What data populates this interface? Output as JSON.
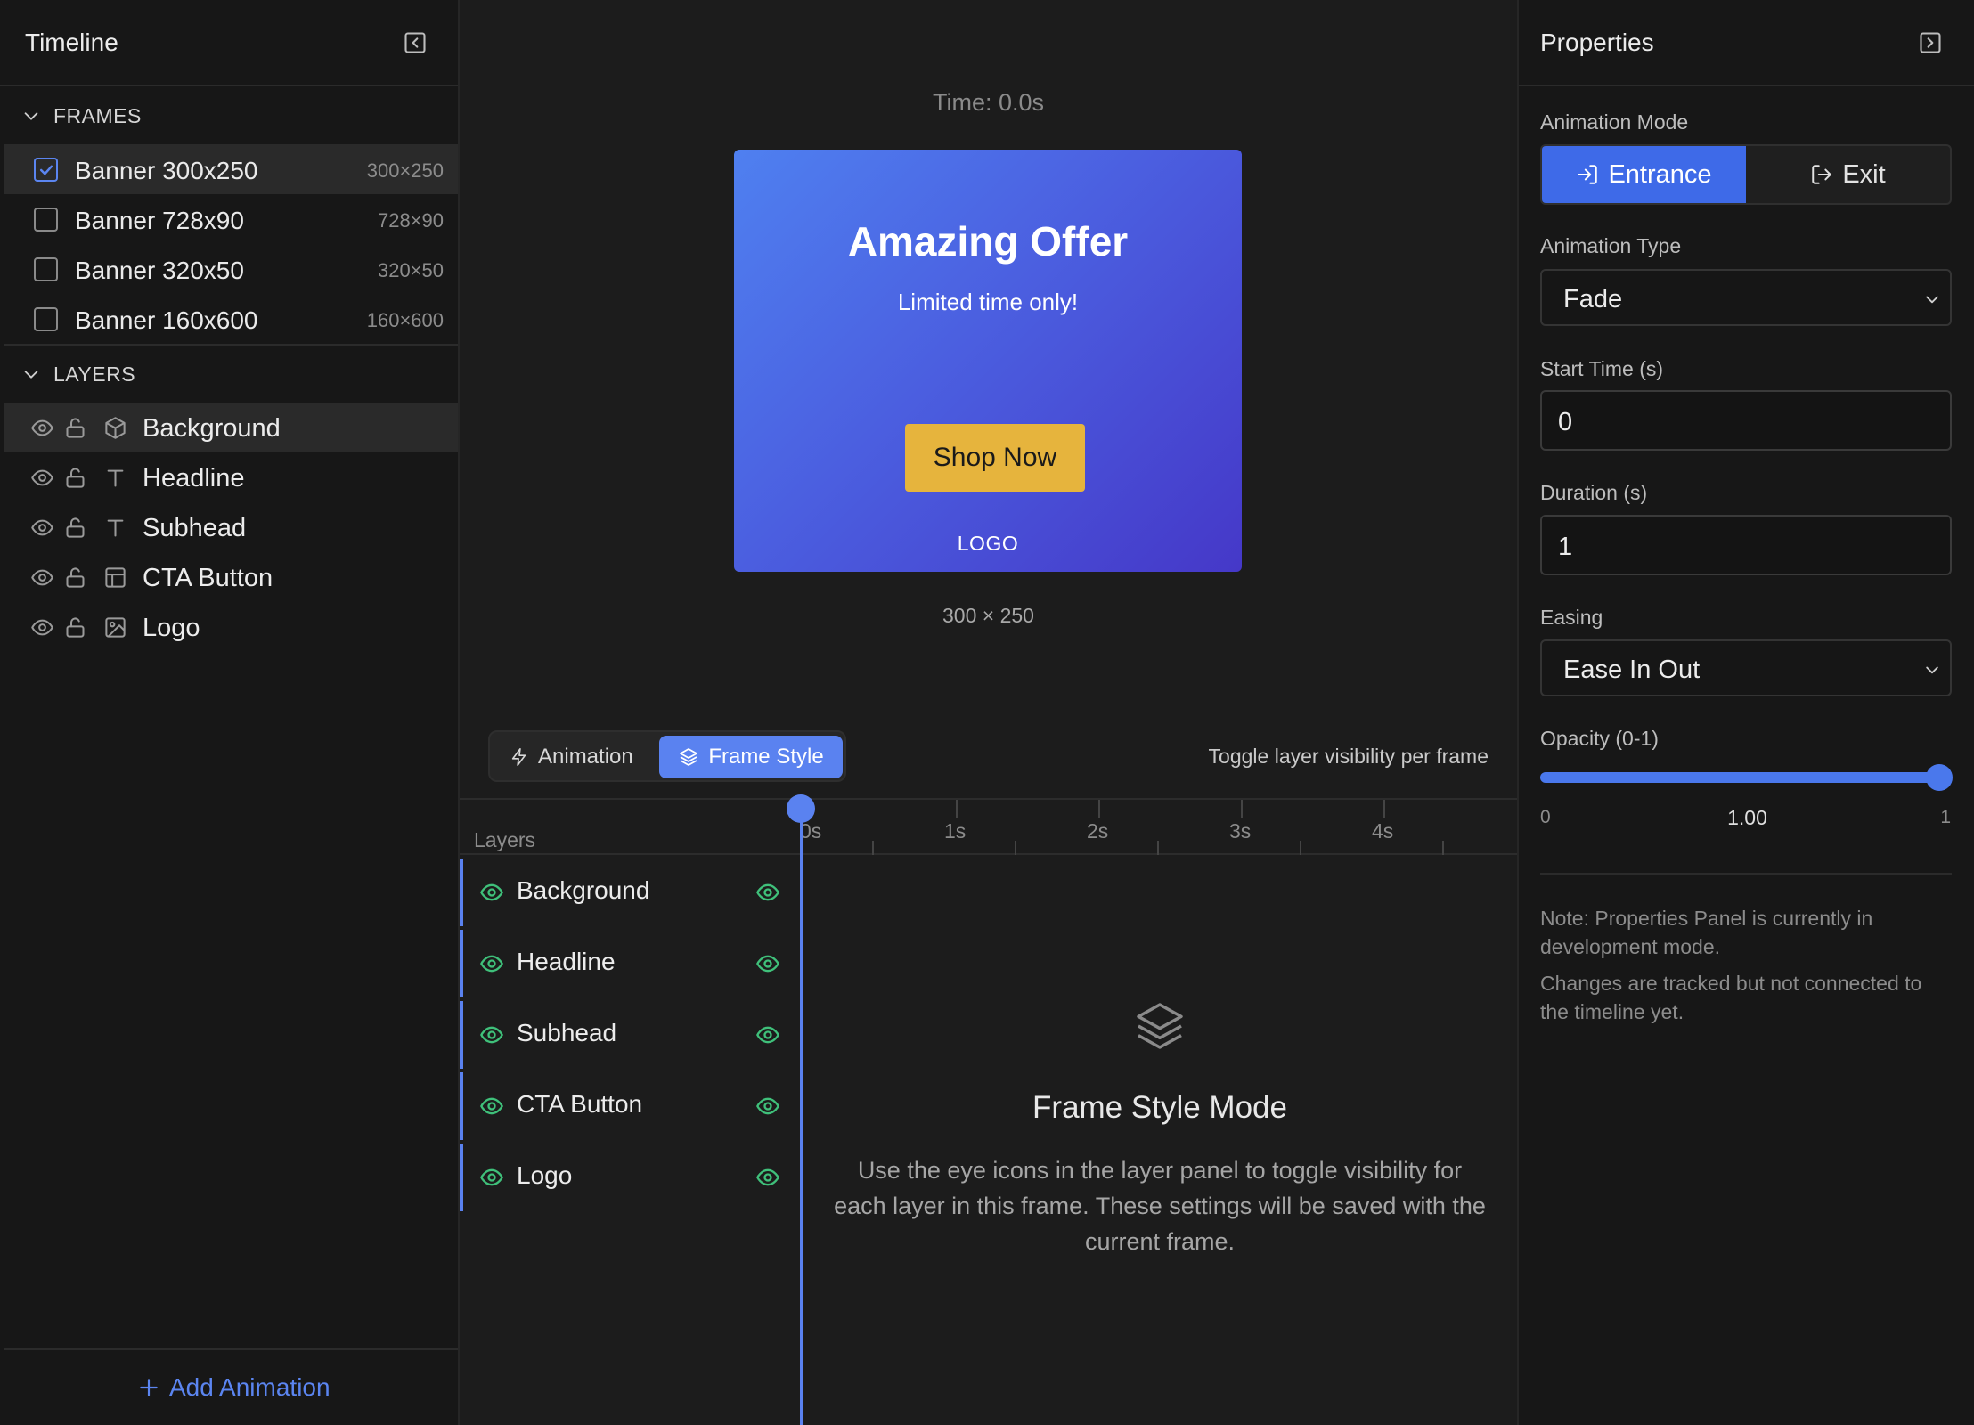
{
  "left_panel": {
    "title": "Timeline",
    "frames_header": "FRAMES",
    "frames": [
      {
        "name": "Banner 300x250",
        "size": "300×250"
      },
      {
        "name": "Banner 728x90",
        "size": "728×90"
      },
      {
        "name": "Banner 320x50",
        "size": "320×50"
      },
      {
        "name": "Banner 160x600",
        "size": "160×600"
      }
    ],
    "layers_header": "LAYERS",
    "layers": [
      {
        "name": "Background",
        "type_icon": "cube-icon"
      },
      {
        "name": "Headline",
        "type_icon": "text-icon"
      },
      {
        "name": "Subhead",
        "type_icon": "text-icon"
      },
      {
        "name": "CTA Button",
        "type_icon": "layout-icon"
      },
      {
        "name": "Logo",
        "type_icon": "image-icon"
      }
    ],
    "add_animation_label": "Add Animation"
  },
  "canvas": {
    "time_label": "Time: 0.0s",
    "banner": {
      "headline": "Amazing Offer",
      "subhead": "Limited time only!",
      "cta": "Shop Now",
      "logo": "LOGO"
    },
    "dimensions": "300 × 250"
  },
  "timeline": {
    "tabs": {
      "animation": "Animation",
      "frame_style": "Frame Style"
    },
    "active_tab": "Frame Style",
    "hint": "Toggle layer visibility per frame",
    "layers_label": "Layers",
    "ticks": [
      "0s",
      "1s",
      "2s",
      "3s",
      "4s"
    ],
    "rows": [
      "Background",
      "Headline",
      "Subhead",
      "CTA Button",
      "Logo"
    ],
    "frame_style_mode": {
      "title": "Frame Style Mode",
      "description": "Use the eye icons in the layer panel to toggle visibility for each layer in this frame. These settings will be saved with the current frame."
    }
  },
  "properties": {
    "title": "Properties",
    "animation_mode_label": "Animation Mode",
    "mode_entrance": "Entrance",
    "mode_exit": "Exit",
    "animation_type_label": "Animation Type",
    "animation_type_value": "Fade",
    "start_time_label": "Start Time (s)",
    "start_time_value": "0",
    "duration_label": "Duration (s)",
    "duration_value": "1",
    "easing_label": "Easing",
    "easing_value": "Ease In Out",
    "opacity_label": "Opacity (0-1)",
    "opacity_min": "0",
    "opacity_value": "1.00",
    "opacity_max": "1",
    "note_1": "Note: Properties Panel is currently in development mode.",
    "note_2": "Changes are tracked but not connected to the timeline yet."
  },
  "colors": {
    "accent": "#5a82f0",
    "eye_green": "#3fc07a",
    "cta_yellow": "#e6b43d"
  }
}
